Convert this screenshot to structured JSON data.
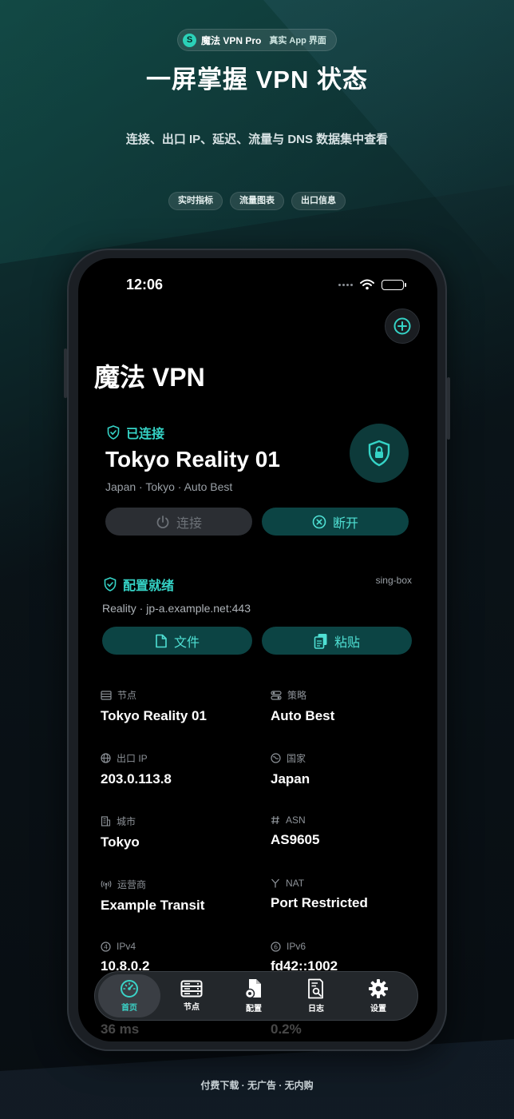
{
  "badge": {
    "logo": "S",
    "name": "魔法 VPN Pro",
    "tag": "真实 App 界面"
  },
  "headline": "一屏掌握 VPN 状态",
  "subline": "连接、出口 IP、延迟、流量与 DNS 数据集中查看",
  "chips": [
    "实时指标",
    "流量图表",
    "出口信息"
  ],
  "footer": "付费下载 · 无广告 · 无内购",
  "statusbar": {
    "time": "12:06",
    "icons": [
      "signal-dots-icon",
      "wifi-icon",
      "battery-icon"
    ]
  },
  "app": {
    "title": "魔法 VPN",
    "add_icon": "plus-circle-icon"
  },
  "connection": {
    "status": "已连接",
    "server": "Tokyo Reality 01",
    "meta": "Japan · Tokyo · Auto Best",
    "connect_label": "连接",
    "disconnect_label": "断开"
  },
  "config": {
    "status": "配置就绪",
    "engine": "sing-box",
    "endpoint": "Reality · jp-a.example.net:443",
    "file_label": "文件",
    "paste_label": "粘贴"
  },
  "info": [
    {
      "label": "节点",
      "value": "Tokyo Reality 01",
      "icon": "server-icon"
    },
    {
      "label": "策略",
      "value": "Auto Best",
      "icon": "toggle-icon"
    },
    {
      "label": "出口 IP",
      "value": "203.0.113.8",
      "icon": "globe-icon"
    },
    {
      "label": "国家",
      "value": "Japan",
      "icon": "globe-stand-icon"
    },
    {
      "label": "城市",
      "value": "Tokyo",
      "icon": "building-icon"
    },
    {
      "label": "ASN",
      "value": "AS9605",
      "icon": "hash-icon"
    },
    {
      "label": "运营商",
      "value": "Example Transit",
      "icon": "antenna-icon"
    },
    {
      "label": "NAT",
      "value": "Port Restricted",
      "icon": "fork-icon"
    },
    {
      "label": "IPv4",
      "value": "10.8.0.2",
      "icon": "four-circle-icon"
    },
    {
      "label": "IPv6",
      "value": "fd42::1002",
      "icon": "six-circle-icon"
    },
    {
      "label": "",
      "value": "36 ms",
      "icon": ""
    },
    {
      "label": "",
      "value": "0.2%",
      "icon": ""
    }
  ],
  "tabs": [
    {
      "label": "首页",
      "icon": "gauge-icon",
      "active": true
    },
    {
      "label": "节点",
      "icon": "server-stack-icon",
      "active": false
    },
    {
      "label": "配置",
      "icon": "doc-gear-icon",
      "active": false
    },
    {
      "label": "日志",
      "icon": "doc-search-icon",
      "active": false
    },
    {
      "label": "设置",
      "icon": "gear-icon",
      "active": false
    }
  ],
  "colors": {
    "accent": "#35d3c6",
    "button_bg": "#0c4444",
    "disabled_bg": "#2b2e33"
  }
}
